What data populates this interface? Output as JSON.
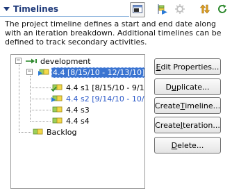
{
  "section": {
    "title": "Timelines",
    "description": "The project timeline defines a start and end date along with an iteration breakdown. Additional timelines can be defined to track secondary activities."
  },
  "toolbar": {
    "buttons": [
      {
        "icon": "layout-toggle-icon",
        "state": "pressed"
      },
      {
        "icon": "run-forward-icon",
        "state": "enabled"
      },
      {
        "icon": "settings-gear-icon",
        "state": "disabled"
      },
      {
        "icon": "sort-up-down-icon",
        "state": "enabled"
      },
      {
        "icon": "refresh-icon",
        "state": "enabled"
      }
    ]
  },
  "tree": {
    "root": {
      "label": "development",
      "expanded": true,
      "icon": "timeline-arrow-icon"
    },
    "items": [
      {
        "label": "4.4 [8/15/10 - 12/13/10]",
        "level": 1,
        "selected": true,
        "expanded": true,
        "icon": "iteration-current-icon"
      },
      {
        "label": "4.4 s1 [8/15/10 - 9/14/",
        "level": 2,
        "selected": false,
        "icon": "iteration-check-icon"
      },
      {
        "label": "4.4 s2 [9/14/10 - 10/14",
        "level": 2,
        "selected": false,
        "icon": "iteration-current-icon",
        "highlight": true
      },
      {
        "label": "4.4 s3",
        "level": 2,
        "selected": false,
        "icon": "iteration-icon"
      },
      {
        "label": "4.4 s4",
        "level": 2,
        "selected": false,
        "icon": "iteration-icon"
      },
      {
        "label": "Backlog",
        "level": 1,
        "selected": false,
        "icon": "iteration-icon"
      }
    ]
  },
  "buttons": {
    "edit_properties": {
      "mn": "E",
      "rest": "dit Properties..."
    },
    "duplicate": {
      "pre": "D",
      "mn": "u",
      "rest": "plicate..."
    },
    "create_timeline": {
      "pre": "Create ",
      "mn": "T",
      "rest": "imeline..."
    },
    "create_iteration": {
      "pre": "Create ",
      "mn": "I",
      "rest": "teration..."
    },
    "delete": {
      "mn": "D",
      "rest": "elete..."
    }
  },
  "colors": {
    "selection": "#3a74d1",
    "title": "#1f3a7a",
    "link_blue": "#2a58c8",
    "iteration_green": "#9ccf5a",
    "iteration_yellow": "#f2d84a"
  }
}
